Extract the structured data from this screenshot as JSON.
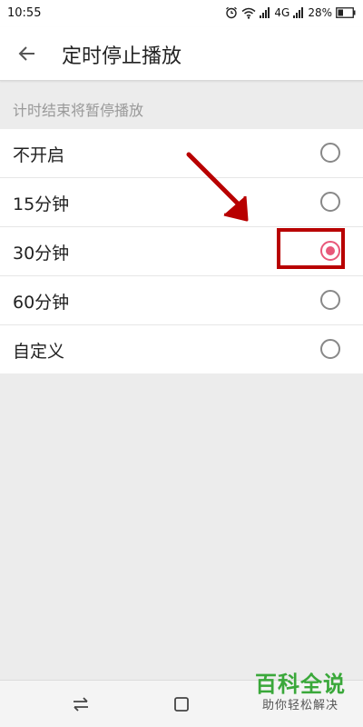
{
  "status_bar": {
    "time": "10:55",
    "network": "4G",
    "battery": "28%",
    "icons": [
      "alarm-icon",
      "wifi-icon",
      "signal-icon",
      "signal-icon",
      "battery-icon"
    ]
  },
  "header": {
    "title": "定时停止播放",
    "back_icon": "back-arrow-icon"
  },
  "section": {
    "label": "计时结束将暂停播放"
  },
  "options": [
    {
      "label": "不开启",
      "selected": false
    },
    {
      "label": "15分钟",
      "selected": false
    },
    {
      "label": "30分钟",
      "selected": true
    },
    {
      "label": "60分钟",
      "selected": false
    },
    {
      "label": "自定义",
      "selected": false
    }
  ],
  "colors": {
    "accent": "#e8587a",
    "annotation": "#b80000",
    "watermark": "#3aa83a"
  },
  "watermark": {
    "main": "百科全说",
    "sub": "助你轻松解决"
  }
}
